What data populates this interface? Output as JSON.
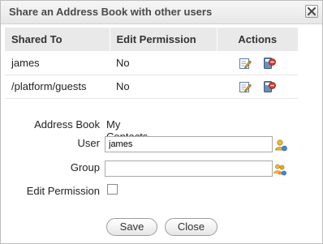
{
  "dialog": {
    "title": "Share an Address Book with other users",
    "close_icon": "close-icon"
  },
  "table": {
    "headers": [
      "Shared To",
      "Edit Permission",
      "Actions"
    ],
    "rows": [
      {
        "shared_to": "james",
        "edit_permission": "No"
      },
      {
        "shared_to": "/platform/guests",
        "edit_permission": "No"
      }
    ],
    "action_icons": [
      "edit-icon",
      "delete-icon"
    ]
  },
  "form": {
    "address_book_label": "Address Book",
    "address_book_value": "My Contacts",
    "user_label": "User",
    "user_value": "james",
    "user_icon": "user-lookup-icon",
    "group_label": "Group",
    "group_value": "",
    "group_icon": "group-lookup-icon",
    "edit_permission_label": "Edit Permission",
    "edit_permission_checked": false
  },
  "buttons": {
    "save": "Save",
    "close": "Close"
  }
}
